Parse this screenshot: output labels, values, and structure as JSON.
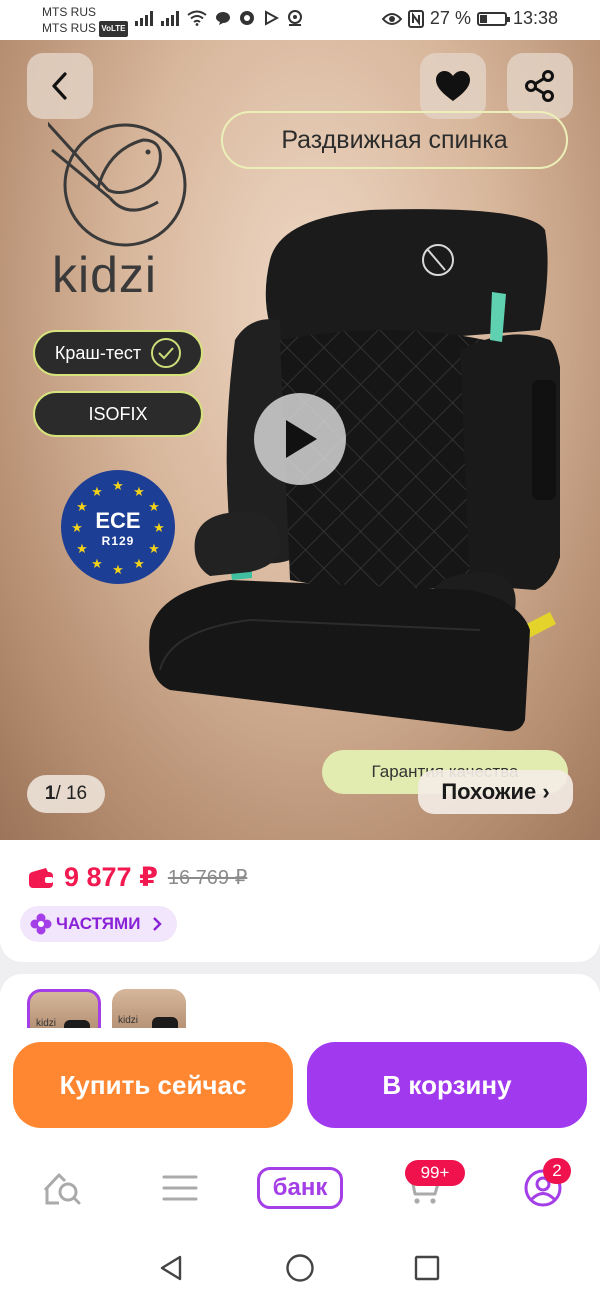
{
  "status_bar": {
    "carrier_1": "MTS RUS",
    "carrier_2": "MTS RUS",
    "volte": "VoLTE",
    "battery_percent": "27 %",
    "battery_level": 0.27,
    "time": "13:38"
  },
  "hero": {
    "feature_tag": "Раздвижная спинка",
    "brand": "kidzi",
    "chips": [
      "Краш-тест",
      "ISOFIX"
    ],
    "ece_title": "ECE",
    "ece_sub": "R129",
    "warranty": "Гарантия качества",
    "counter_current": "1",
    "counter_total": "/ 16",
    "similar": "Похожие ›",
    "icons": {
      "back": "chevron-left-icon",
      "favorite": "heart-icon",
      "share": "share-icon",
      "play": "play-icon"
    }
  },
  "price": {
    "current": "9 877 ₽",
    "old": "16 769 ₽",
    "installments": "ЧАСТЯМИ",
    "colors": {
      "price": "#f1194f",
      "accent": "#a43ee6"
    }
  },
  "thumbnails": {
    "brand": "kidzi"
  },
  "actions": {
    "buy_now": "Купить сейчас",
    "add_to_cart": "В корзину",
    "colors": {
      "buy": "#ff8731",
      "cart": "#a139ef"
    }
  },
  "bottom_nav": {
    "bank": "банк",
    "cart_badge": "99+",
    "profile_badge": "2"
  }
}
